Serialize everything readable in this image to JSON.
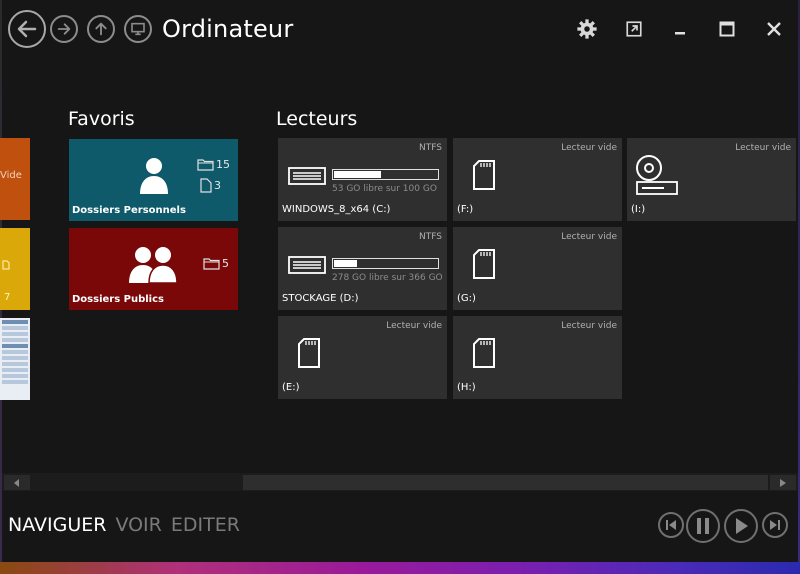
{
  "window": {
    "title": "Ordinateur"
  },
  "sections": {
    "favorites_title": "Favoris",
    "drives_title": "Lecteurs"
  },
  "peek_tiles": {
    "orange_text": "Vide",
    "yellow_count": "7"
  },
  "favorites": [
    {
      "label": "Dossiers Personnels",
      "folders": "15",
      "files": "3",
      "color": "#0e5a6a"
    },
    {
      "label": "Dossiers Publics",
      "folders": "5",
      "color": "#7a0808"
    }
  ],
  "drives": [
    {
      "name": "WINDOWS_8_x64 (C:)",
      "fs": "NTFS",
      "free_text": "53 GO libre sur 100 GO",
      "used_fraction": 0.47,
      "icon": "hdd-icon"
    },
    {
      "name": "(F:)",
      "fs": "Lecteur vide",
      "icon": "sd-card-icon"
    },
    {
      "name": "(I:)",
      "fs": "Lecteur vide",
      "icon": "optical-drive-icon"
    },
    {
      "name": "STOCKAGE (D:)",
      "fs": "NTFS",
      "free_text": "278 GO libre sur 366 GO",
      "used_fraction": 0.24,
      "icon": "hdd-icon"
    },
    {
      "name": "(G:)",
      "fs": "Lecteur vide",
      "icon": "sd-card-icon"
    },
    {
      "name": "(E:)",
      "fs": "Lecteur vide",
      "icon": "sd-card-icon"
    },
    {
      "name": "(H:)",
      "fs": "Lecteur vide",
      "icon": "sd-card-icon"
    }
  ],
  "bottom_nav": {
    "navigate": "NAVIGUER",
    "view": "VOIR",
    "edit": "EDITER"
  },
  "colors": {
    "background": "#161616",
    "drive_tile": "#2f2f2f",
    "accent_orange": "#c0500e",
    "accent_yellow": "#dba80a"
  }
}
